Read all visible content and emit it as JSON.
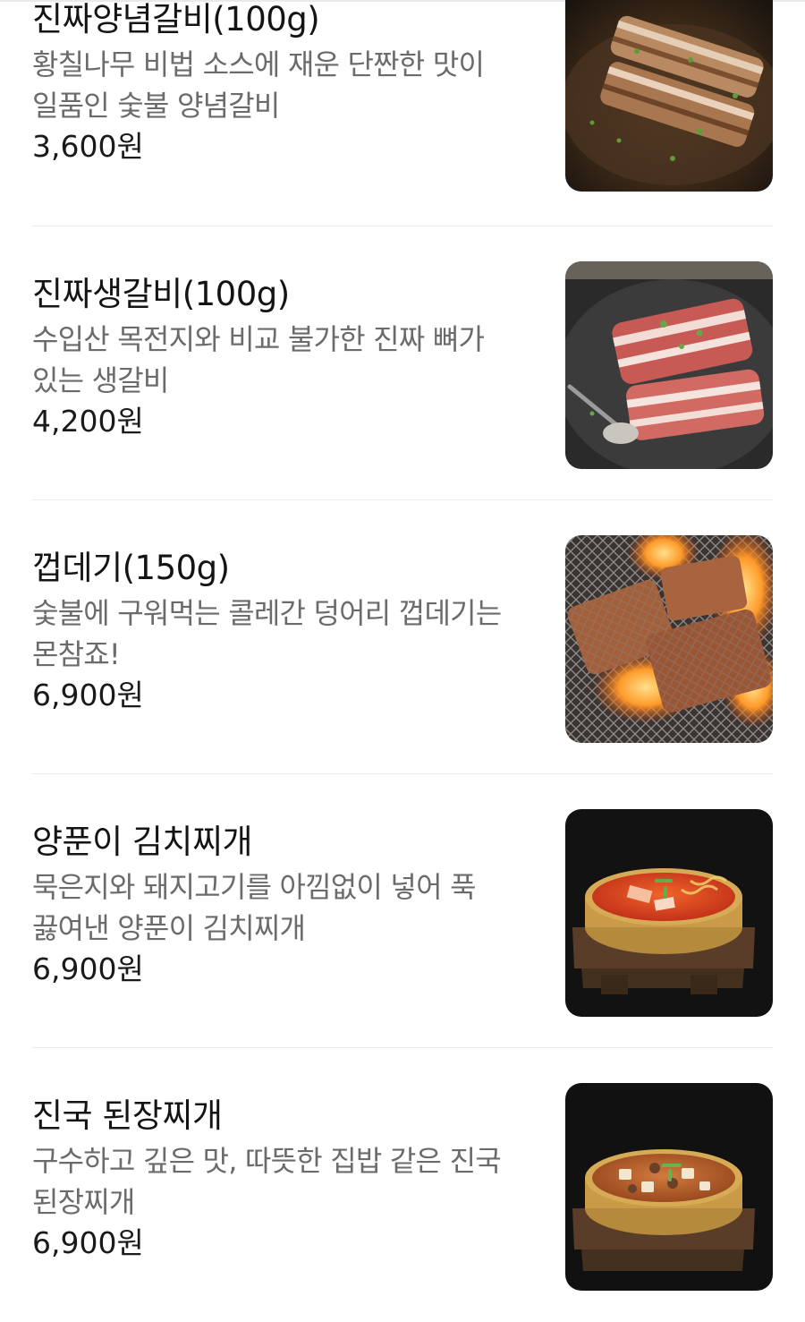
{
  "menu": {
    "items": [
      {
        "name": "진짜양념갈비(100g)",
        "description": "황칠나무 비법 소스에 재운 단짠한 맛이 일품인 숯불 양념갈비",
        "price": "3,600원",
        "image_icon": "marinated-ribs-photo"
      },
      {
        "name": "진짜생갈비(100g)",
        "description": "수입산 목전지와 비교 불가한 진짜 뼈가 있는 생갈비",
        "price": "4,200원",
        "image_icon": "raw-ribs-photo"
      },
      {
        "name": "껍데기(150g)",
        "description": "숯불에 구워먹는 콜레간 덩어리 껍데기는 몬참죠!",
        "price": "6,900원",
        "image_icon": "grilled-pork-skin-photo"
      },
      {
        "name": "양푼이 김치찌개",
        "description": "묵은지와 돼지고기를 아낌없이 넣어 푹 끓여낸 양푼이 김치찌개",
        "price": "6,900원",
        "image_icon": "kimchi-stew-photo"
      },
      {
        "name": "진국 된장찌개",
        "description": "구수하고 깊은 맛, 따뜻한 집밥 같은 진국 된장찌개",
        "price": "6,900원",
        "image_icon": "soybean-stew-photo"
      }
    ]
  }
}
